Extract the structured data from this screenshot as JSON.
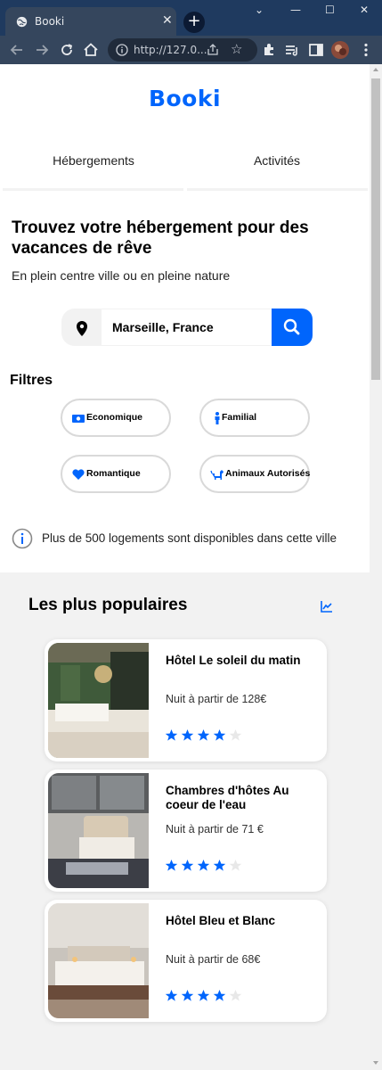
{
  "browser": {
    "tab_title": "Booki",
    "tab_close": "✕",
    "new_tab": "+",
    "url": "http://127.0...",
    "window_controls": {
      "minimize": "—",
      "maximize": "☐",
      "close": "✕",
      "dropdown": "⌄"
    }
  },
  "page": {
    "logo": "Booki",
    "nav": [
      {
        "label": "Hébergements"
      },
      {
        "label": "Activités"
      }
    ],
    "headline": "Trouvez votre hébergement pour des vacances de rêve",
    "subline": "En plein centre ville ou en pleine nature",
    "search": {
      "value": "Marseille, France"
    },
    "filters_title": "Filtres",
    "filters": [
      {
        "label": "Economique",
        "icon": "money-icon"
      },
      {
        "label": "Familial",
        "icon": "person-icon"
      },
      {
        "label": "Romantique",
        "icon": "heart-icon"
      },
      {
        "label": "Animaux Autorisés",
        "icon": "dog-icon"
      }
    ],
    "info_text": "Plus de 500 logements sont disponibles dans cette ville",
    "popular": {
      "title": "Les plus populaires",
      "cards": [
        {
          "title": "Hôtel Le soleil du matin",
          "price": "Nuit à partir de 128€",
          "rating": 4,
          "max_rating": 5
        },
        {
          "title": "Chambres d'hôtes Au coeur de l'eau",
          "price": "Nuit à partir de 71 €",
          "rating": 4,
          "max_rating": 5
        },
        {
          "title": "Hôtel Bleu et Blanc",
          "price": "Nuit à partir de 68€",
          "rating": 4,
          "max_rating": 5
        }
      ]
    }
  },
  "colors": {
    "accent": "#0065fc",
    "chrome_dark": "#1f3a5f",
    "star_off": "#e8e8e8",
    "section_bg": "#f2f2f2"
  }
}
